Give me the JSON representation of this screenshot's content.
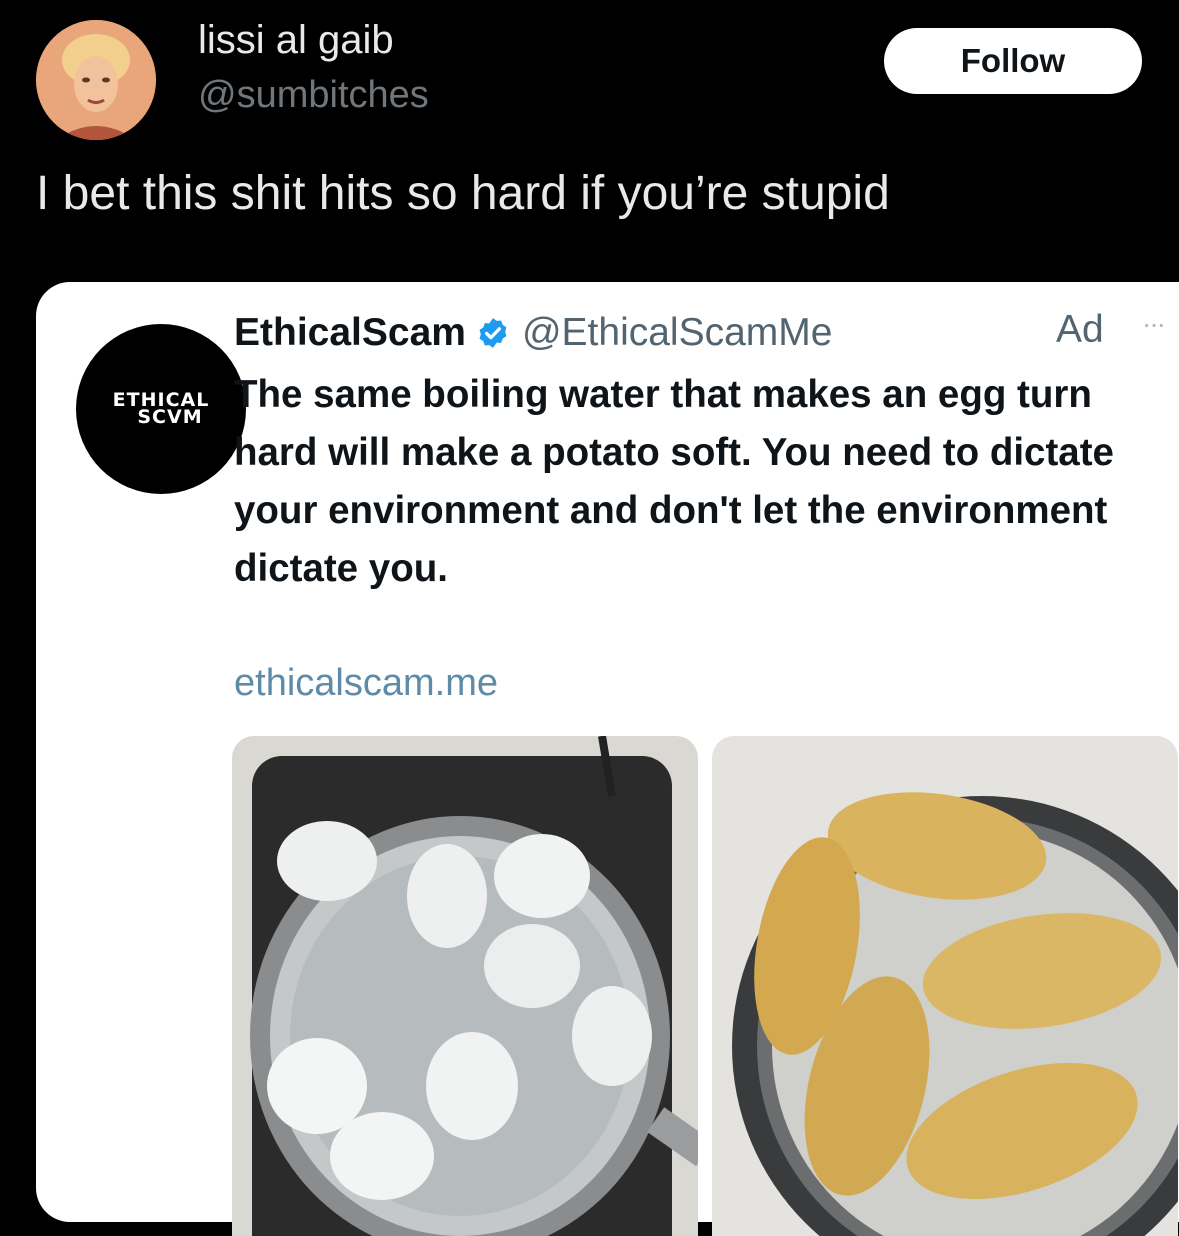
{
  "post": {
    "author_name": "lissi al gaib",
    "author_handle": "@sumbitches",
    "follow_label": "Follow",
    "text": "I bet this shit hits so hard if you’re stupid"
  },
  "quoted": {
    "avatar_line1": "ETHICAL",
    "avatar_line2": "SCVM",
    "name": "EthicalScam",
    "handle": "@EthicalScamMe",
    "ad_label": "Ad",
    "more_label": "···",
    "text": "The same boiling water that makes an egg turn hard will make a potato soft. You need to dictate your environment and don't let the environment dictate you.",
    "link": "ethicalscam.me",
    "verified_color": "#1d9bf0",
    "link_color": "#5e8ba8"
  },
  "icons": [
    "verified-badge-icon",
    "more-options-icon"
  ]
}
